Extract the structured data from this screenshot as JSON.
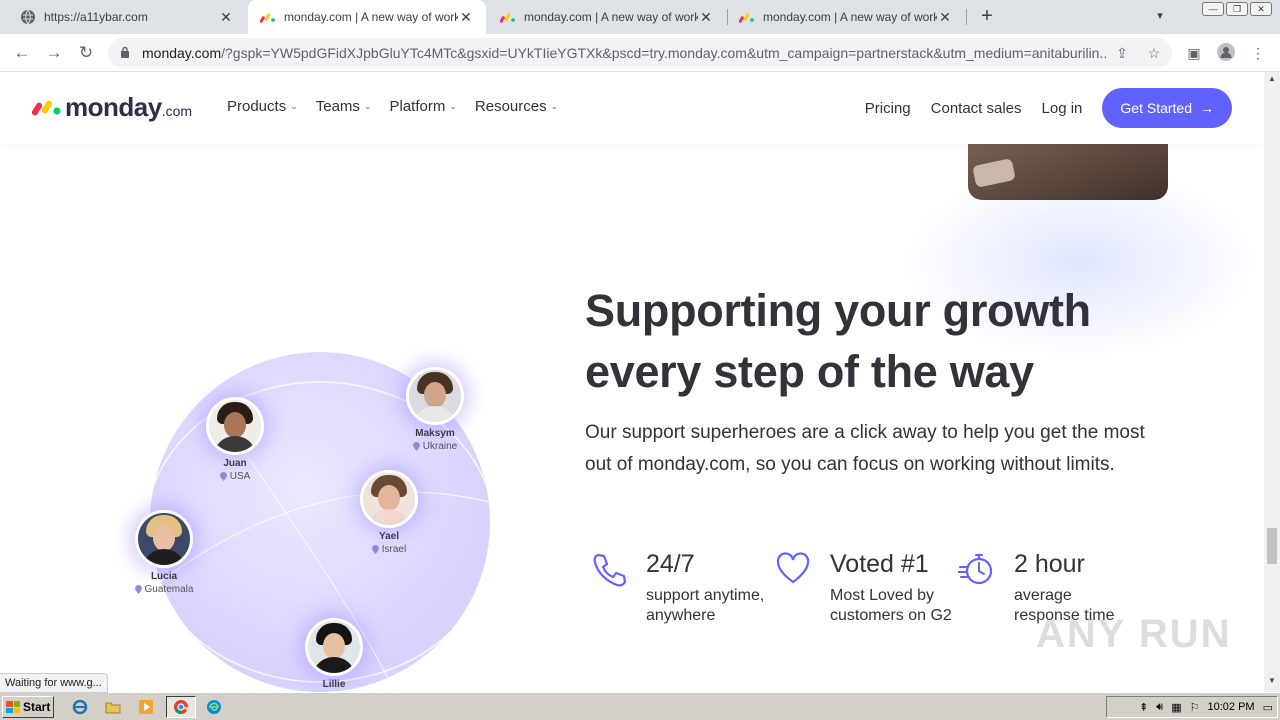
{
  "browser": {
    "tabs": [
      {
        "title": "https://a11ybar.com",
        "active": false
      },
      {
        "title": "monday.com | A new way of working",
        "active": true
      },
      {
        "title": "monday.com | A new way of working",
        "active": false
      },
      {
        "title": "monday.com | A new way of working",
        "active": false
      }
    ],
    "url_host": "monday.com",
    "url_rest": "/?gspk=YW5pdGFidXJpbGluYTc4MTc&gsxid=UYkTIieYGTXk&pscd=try.monday.com&utm_campaign=partnerstack&utm_medium=anitaburilin...",
    "status_text": "Waiting for www.g..."
  },
  "site": {
    "logo_word": "monday",
    "logo_tld": ".com",
    "nav": [
      {
        "label": "Products"
      },
      {
        "label": "Teams"
      },
      {
        "label": "Platform"
      },
      {
        "label": "Resources"
      }
    ],
    "pricing": "Pricing",
    "contact_sales": "Contact sales",
    "login": "Log in",
    "cta": "Get Started"
  },
  "section": {
    "headline": "Supporting your growth every step of the way",
    "description": "Our support superheroes are a click away to help you get the most out of monday.com, so you can focus on working without limits.",
    "stats": [
      {
        "value": "24/7",
        "caption": "support anytime, anywhere",
        "icon": "phone-icon"
      },
      {
        "value": "Voted #1",
        "caption": "Most Loved by customers on G2",
        "icon": "heart-icon"
      },
      {
        "value": "2 hour",
        "caption": "average response time",
        "icon": "stopwatch-icon"
      }
    ],
    "people": [
      {
        "name": "Juan",
        "location": "USA"
      },
      {
        "name": "Maksym",
        "location": "Ukraine"
      },
      {
        "name": "Yael",
        "location": "Israel"
      },
      {
        "name": "Lucia",
        "location": "Guatemala"
      },
      {
        "name": "Lillie",
        "location": ""
      }
    ]
  },
  "watermark": "ANY RUN",
  "taskbar": {
    "start_label": "Start",
    "clock": "10:02 PM"
  },
  "colors": {
    "brand_purple": "#6161ff",
    "text_dark": "#323338"
  }
}
